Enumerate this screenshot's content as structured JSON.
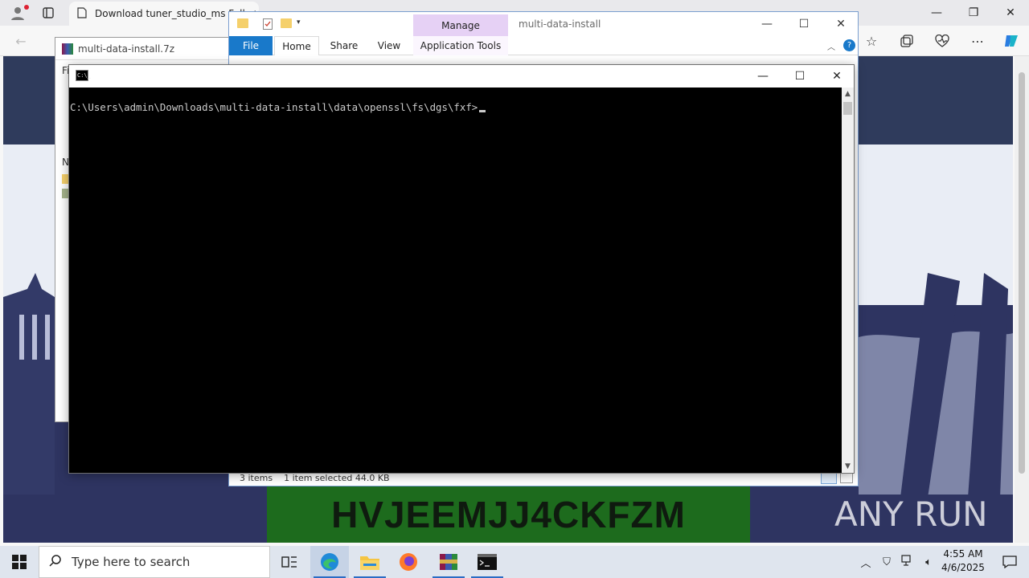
{
  "browser": {
    "tab_title": "Download tuner_studio_ms Full",
    "tab_close": "✕",
    "window_controls": {
      "minimize": "—",
      "restore": "❐",
      "close": "✕"
    },
    "toolbar_icons": [
      "back-icon",
      "favorites-icon",
      "collections-icon",
      "performance-icon",
      "more-icon",
      "copilot-icon"
    ]
  },
  "sevenz": {
    "title": "multi-data-install.7z",
    "fragment_label": "Fi",
    "fragment_col": "N"
  },
  "explorer": {
    "manage_label": "Manage",
    "title": "multi-data-install",
    "ribbon_tabs": [
      "File",
      "Home",
      "Share",
      "View",
      "Application Tools"
    ],
    "status_items": "3 items",
    "status_selected": "1 item selected  44.0 KB",
    "help": "?"
  },
  "cmd": {
    "prompt": "C:\\Users\\admin\\Downloads\\multi-data-install\\data\\openssl\\fs\\dgs\\fxf>",
    "icon_text": "C:\\_",
    "minimize": "—",
    "maximize": "☐",
    "close": "✕"
  },
  "webpage": {
    "banner_code": "HVJEEMJJ4CKFZM",
    "watermark": "ANY RUN"
  },
  "taskbar": {
    "search_placeholder": "Type here to search",
    "time": "4:55 AM",
    "date": "4/6/2025",
    "accent": "#2b6cc4"
  }
}
